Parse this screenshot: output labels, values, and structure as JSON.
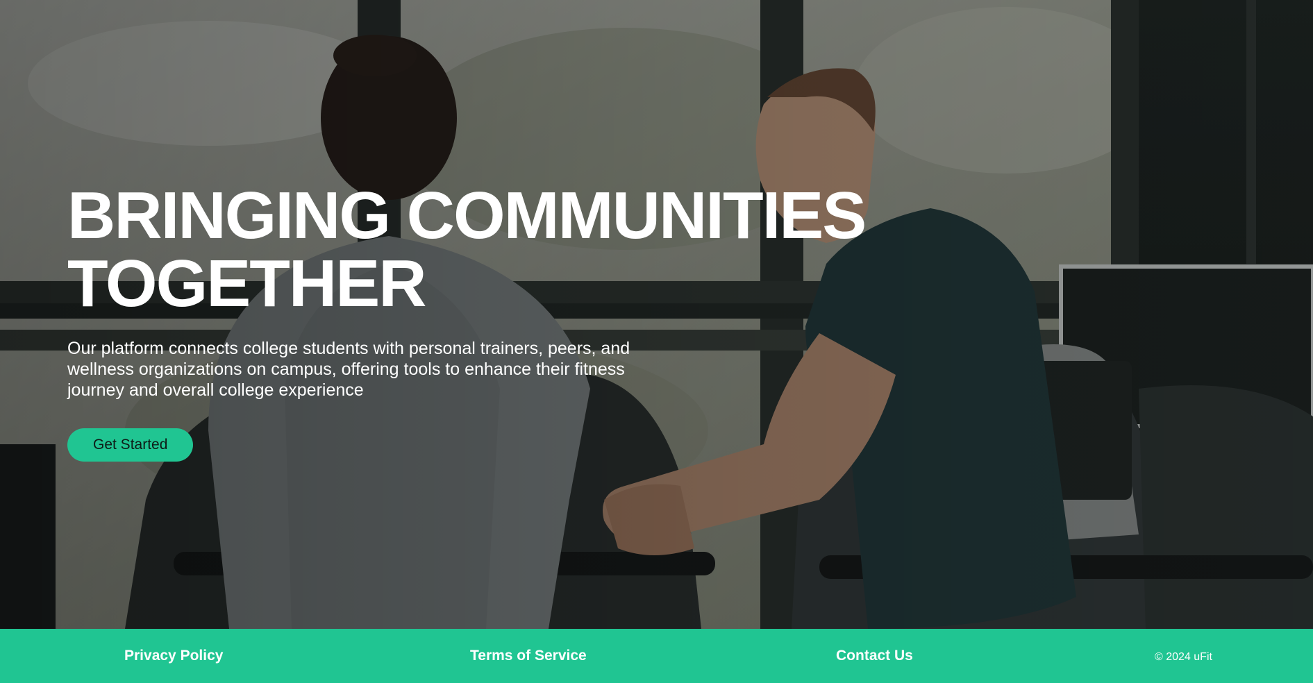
{
  "hero": {
    "title_line1": "BRINGING COMMUNITIES",
    "title_line2": "TOGETHER",
    "subtitle": "Our platform connects college students with personal trainers, peers, and wellness organizations on campus, offering tools to enhance their fitness journey and overall college experience",
    "cta_label": "Get Started",
    "background_icon": "gym-treadmill-photo"
  },
  "footer": {
    "privacy_label": "Privacy Policy",
    "terms_label": "Terms of Service",
    "contact_label": "Contact Us",
    "copyright": "© 2024 uFit"
  },
  "colors": {
    "accent": "#20c592",
    "text_light": "#ffffff",
    "button_text": "#0d1b16"
  }
}
